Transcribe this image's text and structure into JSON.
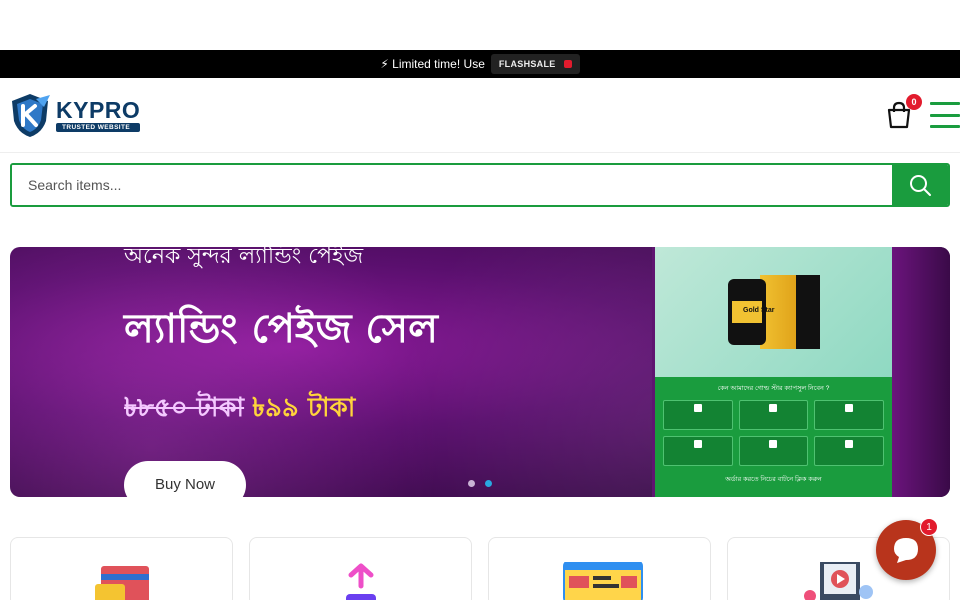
{
  "promo": {
    "text": "⚡ Limited time! Use",
    "code": "FLASHSALE"
  },
  "logo": {
    "name": "KYPRO",
    "tagline": "TRUSTED WEBSITE"
  },
  "cart": {
    "count": "0"
  },
  "search": {
    "placeholder": "Search items..."
  },
  "banner": {
    "subtitle": "অনেক সুন্দর ল্যান্ডিং পেইজ",
    "title": "ল্যান্ডিং পেইজ সেল",
    "old_price": "৳৮৫০ টাকা",
    "new_price": "৳৯৯ টাকা",
    "button": "Buy Now",
    "product_label": "Gold Star",
    "panel_heading": "কেন আমাদের গোল্ড স্টার ক্যাপসুল নিবেন ?",
    "panel_footer": "অর্ডার করতে নিচের বাটনে ক্লিক করুন",
    "slides": 2,
    "active_slide": 2
  },
  "chat": {
    "badge": "1"
  },
  "colors": {
    "brand_green": "#1a9c3e",
    "brand_navy": "#0d3b66",
    "badge_red": "#e21b2d",
    "chat_orange": "#b8341c"
  }
}
